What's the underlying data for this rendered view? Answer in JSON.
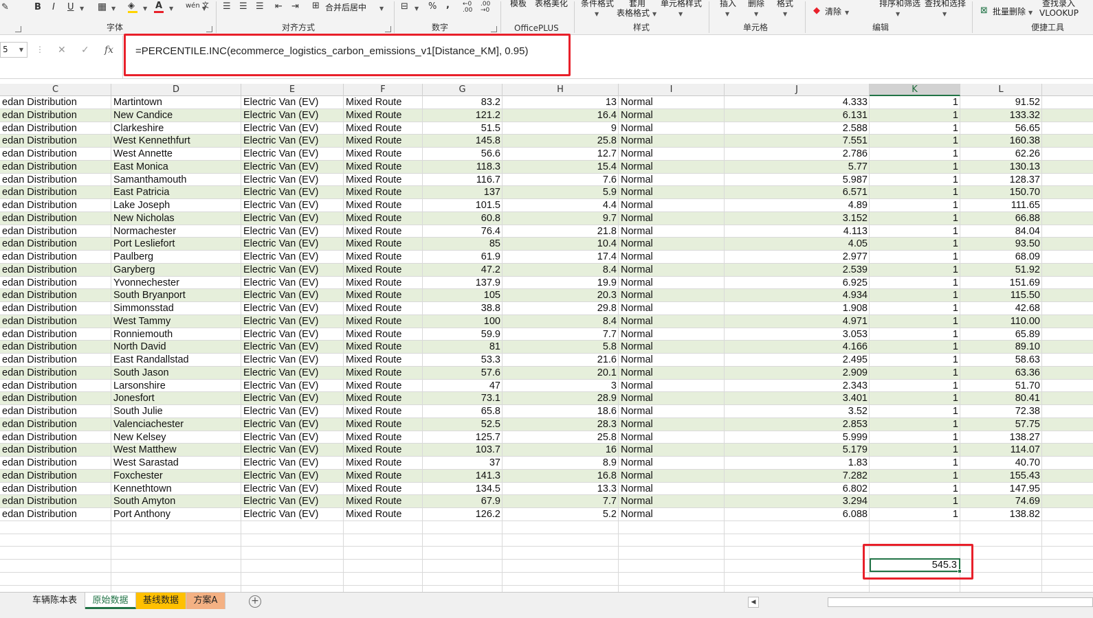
{
  "ribbon": {
    "font": {
      "label": "字体",
      "bold": "B",
      "italic": "I",
      "underline": "U",
      "phonetic": "wén 文",
      "fill_color": "#ffd400",
      "font_color": "#e8202a"
    },
    "align": {
      "label": "对齐方式",
      "merge_label": "合并后居中"
    },
    "number": {
      "label": "数字",
      "percent": "%",
      "comma": ","
    },
    "officeplus": {
      "label": "OfficePLUS",
      "template": "模板",
      "table_beautify": "表格美化"
    },
    "styles": {
      "label": "样式",
      "conditional": "条件格式",
      "table_format_top": "套用",
      "table_format_bottom": "表格格式",
      "cell_styles": "单元格样式"
    },
    "cells": {
      "label": "单元格",
      "insert": "插入",
      "delete": "删除",
      "format": "格式"
    },
    "editing": {
      "label": "编辑",
      "clear": "清除",
      "sort_filter": "排序和筛选",
      "find_select": "查找和选择"
    },
    "tools": {
      "label": "便捷工具",
      "batch_delete": "批量删除",
      "find_entry": "查找录入",
      "vlookup": "VLOOKUP"
    }
  },
  "formula_bar": {
    "name_box": "5",
    "formula": "=PERCENTILE.INC(ecommerce_logistics_carbon_emissions_v1[Distance_KM], 0.95)",
    "highlight_color": "#e8202a"
  },
  "columns": [
    "C",
    "D",
    "E",
    "F",
    "G",
    "H",
    "I",
    "J",
    "K",
    "L"
  ],
  "rows": [
    [
      "edan Distribution",
      "Martintown",
      "Electric Van (EV)",
      "Mixed Route",
      "83.2",
      "13",
      "Normal",
      "4.333",
      "1",
      "91.52"
    ],
    [
      "edan Distribution",
      "New Candice",
      "Electric Van (EV)",
      "Mixed Route",
      "121.2",
      "16.4",
      "Normal",
      "6.131",
      "1",
      "133.32"
    ],
    [
      "edan Distribution",
      "Clarkeshire",
      "Electric Van (EV)",
      "Mixed Route",
      "51.5",
      "9",
      "Normal",
      "2.588",
      "1",
      "56.65"
    ],
    [
      "edan Distribution",
      "West Kennethfurt",
      "Electric Van (EV)",
      "Mixed Route",
      "145.8",
      "25.8",
      "Normal",
      "7.551",
      "1",
      "160.38"
    ],
    [
      "edan Distribution",
      "West Annette",
      "Electric Van (EV)",
      "Mixed Route",
      "56.6",
      "12.7",
      "Normal",
      "2.786",
      "1",
      "62.26"
    ],
    [
      "edan Distribution",
      "East Monica",
      "Electric Van (EV)",
      "Mixed Route",
      "118.3",
      "15.4",
      "Normal",
      "5.77",
      "1",
      "130.13"
    ],
    [
      "edan Distribution",
      "Samanthamouth",
      "Electric Van (EV)",
      "Mixed Route",
      "116.7",
      "7.6",
      "Normal",
      "5.987",
      "1",
      "128.37"
    ],
    [
      "edan Distribution",
      "East Patricia",
      "Electric Van (EV)",
      "Mixed Route",
      "137",
      "5.9",
      "Normal",
      "6.571",
      "1",
      "150.70"
    ],
    [
      "edan Distribution",
      "Lake Joseph",
      "Electric Van (EV)",
      "Mixed Route",
      "101.5",
      "4.4",
      "Normal",
      "4.89",
      "1",
      "111.65"
    ],
    [
      "edan Distribution",
      "New Nicholas",
      "Electric Van (EV)",
      "Mixed Route",
      "60.8",
      "9.7",
      "Normal",
      "3.152",
      "1",
      "66.88"
    ],
    [
      "edan Distribution",
      "Normachester",
      "Electric Van (EV)",
      "Mixed Route",
      "76.4",
      "21.8",
      "Normal",
      "4.113",
      "1",
      "84.04"
    ],
    [
      "edan Distribution",
      "Port Lesliefort",
      "Electric Van (EV)",
      "Mixed Route",
      "85",
      "10.4",
      "Normal",
      "4.05",
      "1",
      "93.50"
    ],
    [
      "edan Distribution",
      "Paulberg",
      "Electric Van (EV)",
      "Mixed Route",
      "61.9",
      "17.4",
      "Normal",
      "2.977",
      "1",
      "68.09"
    ],
    [
      "edan Distribution",
      "Garyberg",
      "Electric Van (EV)",
      "Mixed Route",
      "47.2",
      "8.4",
      "Normal",
      "2.539",
      "1",
      "51.92"
    ],
    [
      "edan Distribution",
      "Yvonnechester",
      "Electric Van (EV)",
      "Mixed Route",
      "137.9",
      "19.9",
      "Normal",
      "6.925",
      "1",
      "151.69"
    ],
    [
      "edan Distribution",
      "South Bryanport",
      "Electric Van (EV)",
      "Mixed Route",
      "105",
      "20.3",
      "Normal",
      "4.934",
      "1",
      "115.50"
    ],
    [
      "edan Distribution",
      "Simmonsstad",
      "Electric Van (EV)",
      "Mixed Route",
      "38.8",
      "29.8",
      "Normal",
      "1.908",
      "1",
      "42.68"
    ],
    [
      "edan Distribution",
      "West Tammy",
      "Electric Van (EV)",
      "Mixed Route",
      "100",
      "8.4",
      "Normal",
      "4.971",
      "1",
      "110.00"
    ],
    [
      "edan Distribution",
      "Ronniemouth",
      "Electric Van (EV)",
      "Mixed Route",
      "59.9",
      "7.7",
      "Normal",
      "3.053",
      "1",
      "65.89"
    ],
    [
      "edan Distribution",
      "North David",
      "Electric Van (EV)",
      "Mixed Route",
      "81",
      "5.8",
      "Normal",
      "4.166",
      "1",
      "89.10"
    ],
    [
      "edan Distribution",
      "East Randallstad",
      "Electric Van (EV)",
      "Mixed Route",
      "53.3",
      "21.6",
      "Normal",
      "2.495",
      "1",
      "58.63"
    ],
    [
      "edan Distribution",
      "South Jason",
      "Electric Van (EV)",
      "Mixed Route",
      "57.6",
      "20.1",
      "Normal",
      "2.909",
      "1",
      "63.36"
    ],
    [
      "edan Distribution",
      "Larsonshire",
      "Electric Van (EV)",
      "Mixed Route",
      "47",
      "3",
      "Normal",
      "2.343",
      "1",
      "51.70"
    ],
    [
      "edan Distribution",
      "Jonesfort",
      "Electric Van (EV)",
      "Mixed Route",
      "73.1",
      "28.9",
      "Normal",
      "3.401",
      "1",
      "80.41"
    ],
    [
      "edan Distribution",
      "South Julie",
      "Electric Van (EV)",
      "Mixed Route",
      "65.8",
      "18.6",
      "Normal",
      "3.52",
      "1",
      "72.38"
    ],
    [
      "edan Distribution",
      "Valenciachester",
      "Electric Van (EV)",
      "Mixed Route",
      "52.5",
      "28.3",
      "Normal",
      "2.853",
      "1",
      "57.75"
    ],
    [
      "edan Distribution",
      "New Kelsey",
      "Electric Van (EV)",
      "Mixed Route",
      "125.7",
      "25.8",
      "Normal",
      "5.999",
      "1",
      "138.27"
    ],
    [
      "edan Distribution",
      "West Matthew",
      "Electric Van (EV)",
      "Mixed Route",
      "103.7",
      "16",
      "Normal",
      "5.179",
      "1",
      "114.07"
    ],
    [
      "edan Distribution",
      "West Sarastad",
      "Electric Van (EV)",
      "Mixed Route",
      "37",
      "8.9",
      "Normal",
      "1.83",
      "1",
      "40.70"
    ],
    [
      "edan Distribution",
      "Foxchester",
      "Electric Van (EV)",
      "Mixed Route",
      "141.3",
      "16.8",
      "Normal",
      "7.282",
      "1",
      "155.43"
    ],
    [
      "edan Distribution",
      "Kennethtown",
      "Electric Van (EV)",
      "Mixed Route",
      "134.5",
      "13.3",
      "Normal",
      "6.802",
      "1",
      "147.95"
    ],
    [
      "edan Distribution",
      "South Amyton",
      "Electric Van (EV)",
      "Mixed Route",
      "67.9",
      "7.7",
      "Normal",
      "3.294",
      "1",
      "74.69"
    ],
    [
      "edan Distribution",
      "Port Anthony",
      "Electric Van (EV)",
      "Mixed Route",
      "126.2",
      "5.2",
      "Normal",
      "6.088",
      "1",
      "138.82"
    ]
  ],
  "result_cell": {
    "value": "545.3"
  },
  "sheet_tabs": [
    {
      "label": "车辆陈本表",
      "style": "normal"
    },
    {
      "label": "原始数据",
      "style": "active"
    },
    {
      "label": "基线数据",
      "style": "yellow"
    },
    {
      "label": "方案A",
      "style": "orange"
    }
  ],
  "colors": {
    "accent": "#217346",
    "alt_row": "#e6efdb",
    "highlight": "#e8202a"
  }
}
